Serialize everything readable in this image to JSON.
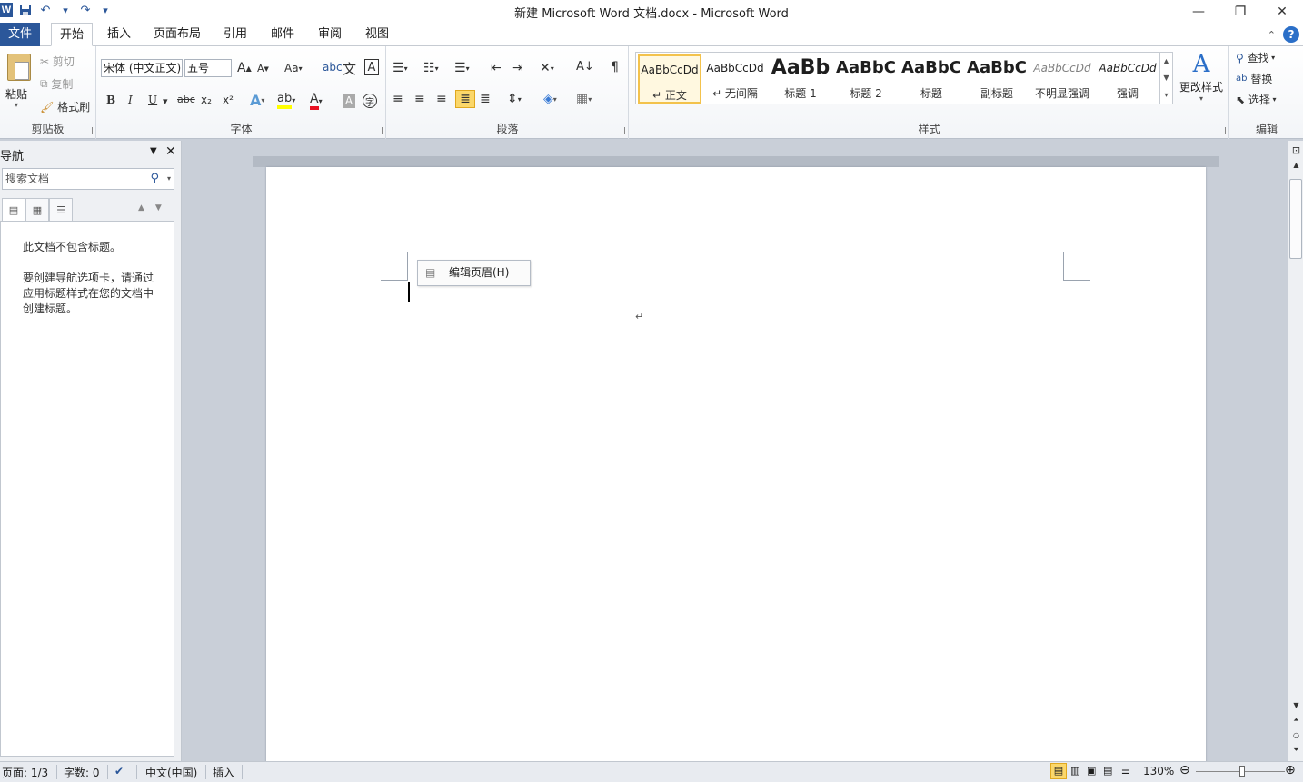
{
  "window": {
    "title": "新建 Microsoft Word 文档.docx  -  Microsoft Word",
    "app_icon": "W",
    "qat": [
      "save-icon",
      "undo-icon",
      "redo-icon",
      "customize-icon"
    ],
    "controls": [
      "—",
      "❐",
      "✕"
    ]
  },
  "tabs": {
    "file": "文件",
    "items": [
      "开始",
      "插入",
      "页面布局",
      "引用",
      "邮件",
      "审阅",
      "视图"
    ],
    "active": "开始"
  },
  "ribbon": {
    "clipboard": {
      "paste": "粘贴",
      "cut": "剪切",
      "copy": "复制",
      "format_painter": "格式刷",
      "label": "剪贴板"
    },
    "font": {
      "font_name": "宋体 (中文正文)",
      "font_size": "五号",
      "bold": "B",
      "italic": "I",
      "underline": "U",
      "strike": "abc",
      "subscript": "x₂",
      "superscript": "x²",
      "grow": "A",
      "shrink": "A",
      "change_case": "Aa",
      "label": "字体"
    },
    "paragraph": {
      "label": "段落"
    },
    "styles": {
      "items": [
        {
          "sample": "AaBbCcDd",
          "name": "↵ 正文"
        },
        {
          "sample": "AaBbCcDd",
          "name": "↵ 无间隔"
        },
        {
          "sample": "AaBb",
          "name": "标题 1"
        },
        {
          "sample": "AaBbC",
          "name": "标题 2"
        },
        {
          "sample": "AaBbC",
          "name": "标题"
        },
        {
          "sample": "AaBbC",
          "name": "副标题"
        },
        {
          "sample": "AaBbCcDd",
          "name": "不明显强调"
        },
        {
          "sample": "AaBbCcDd",
          "name": "强调"
        }
      ],
      "change_styles": "更改样式",
      "label": "样式"
    },
    "editing": {
      "find": "查找",
      "replace": "替换",
      "select": "选择",
      "label": "编辑"
    }
  },
  "nav": {
    "title": "导航",
    "search_placeholder": "搜索文档",
    "msg1": "此文档不包含标题。",
    "msg2": "要创建导航选项卡，请通过应用标题样式在您的文档中创建标题。"
  },
  "document": {
    "edit_header": "编辑页眉(H)",
    "paragraph_mark": "↵"
  },
  "status": {
    "page": "页面: 1/3",
    "words": "字数: 0",
    "language": "中文(中国)",
    "mode": "插入",
    "zoom": "130%"
  },
  "colors": {
    "file_tab": "#2b579a",
    "selected_style": "#f3c24c",
    "highlight": "#ffff00",
    "font_color": "#e81123"
  }
}
